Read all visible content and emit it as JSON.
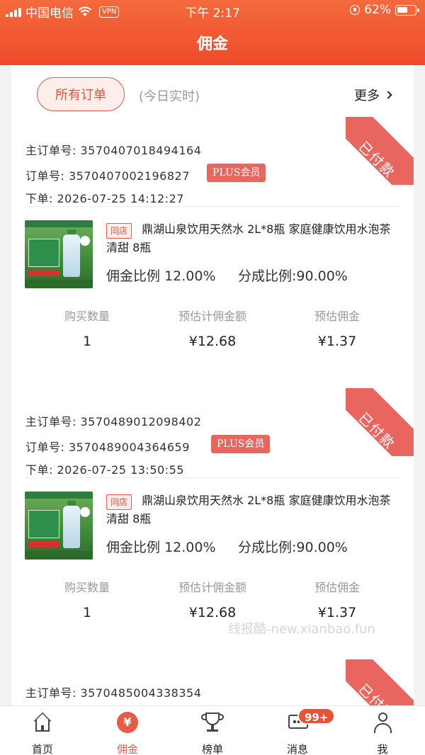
{
  "status_bar": {
    "carrier": "中国电信",
    "vpn": "VPN",
    "time": "下午 2:17",
    "battery": "62%",
    "battery_level": 0.62
  },
  "header": {
    "title": "佣金"
  },
  "filter_tabs": {
    "all_orders": "所有订单",
    "today_realtime": "(今日实时)",
    "more": "更多"
  },
  "labels": {
    "main_order_no": "主订单号:",
    "order_no": "订单号:",
    "placed": "下单:",
    "paid_ribbon": "已付款",
    "plus_member": "PLUS会员",
    "same_store": "同店",
    "commission_rate": "佣金比例",
    "share_rate": "分成比例:",
    "qty": "购买数量",
    "est_commission_amount": "预估计佣金额",
    "est_commission": "预估佣金"
  },
  "orders": [
    {
      "main_order_no": "3570407018494164",
      "order_no": "3570407002196827",
      "placed_at": "2026-07-25 14:12:27",
      "product_title": "鼎湖山泉饮用天然水 2L*8瓶 家庭健康饮用水泡茶清甜 8瓶",
      "commission_rate": "12.00%",
      "share_rate": "90.00%",
      "qty": "1",
      "est_commission_amount": "¥12.68",
      "est_commission": "¥1.37"
    },
    {
      "main_order_no": "3570489012098402",
      "order_no": "3570489004364659",
      "placed_at": "2026-07-25 13:50:55",
      "product_title": "鼎湖山泉饮用天然水 2L*8瓶 家庭健康饮用水泡茶清甜 8瓶",
      "commission_rate": "12.00%",
      "share_rate": "90.00%",
      "qty": "1",
      "est_commission_amount": "¥12.68",
      "est_commission": "¥1.37"
    },
    {
      "main_order_no": "3570485004338354"
    }
  ],
  "watermark": "线报酷-new.xianbao.fun",
  "tabbar": {
    "items": [
      {
        "label": "首页",
        "icon": "home-icon"
      },
      {
        "label": "佣金",
        "icon": "yen-icon",
        "active": true
      },
      {
        "label": "榜单",
        "icon": "trophy-icon"
      },
      {
        "label": "消息",
        "icon": "message-icon"
      },
      {
        "label": "我",
        "icon": "user-icon"
      }
    ],
    "message_badge": "99+",
    "yen_symbol": "¥"
  },
  "colors": {
    "brand": "#ee4b2b",
    "accent": "#e85b45",
    "ribbon": "#e96660"
  }
}
